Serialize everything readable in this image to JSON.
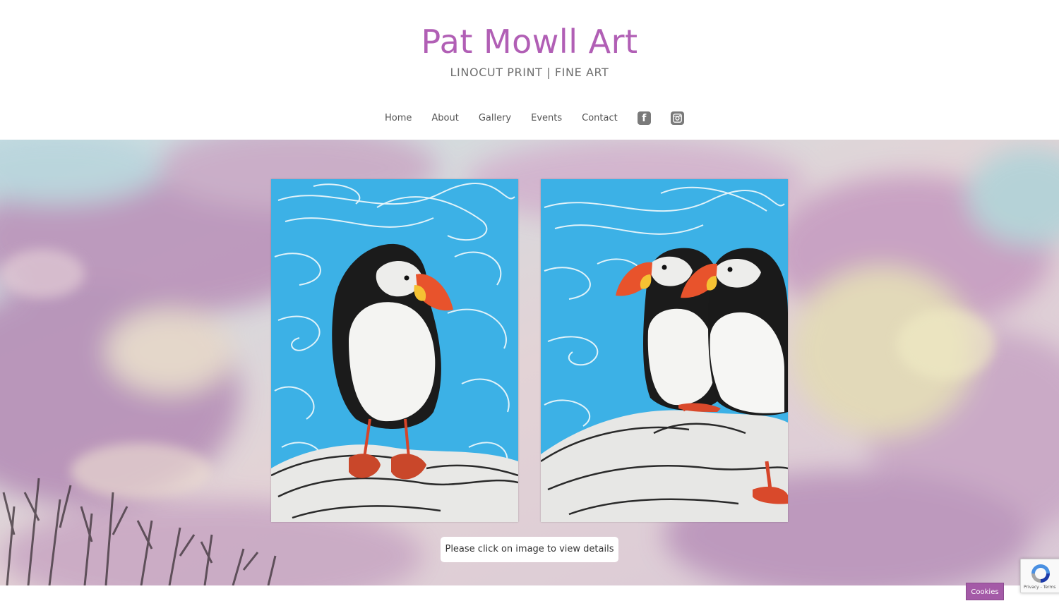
{
  "header": {
    "title": "Pat Mowll Art",
    "tagline": "LINOCUT PRINT | FINE ART"
  },
  "nav": {
    "items": [
      {
        "label": "Home"
      },
      {
        "label": "About"
      },
      {
        "label": "Gallery"
      },
      {
        "label": "Events"
      },
      {
        "label": "Contact"
      }
    ],
    "social": [
      {
        "icon": "facebook-icon"
      },
      {
        "icon": "instagram-icon"
      }
    ]
  },
  "hero": {
    "artworks": [
      {
        "subject": "single puffin on rocks"
      },
      {
        "subject": "two puffins on rocks"
      }
    ],
    "hint": "Please click on image to view details"
  },
  "recaptcha": {
    "terms": "Privacy - Terms"
  },
  "cookies": {
    "label": "Cookies"
  },
  "colors": {
    "brand": "#b15fb5",
    "tagline": "#707070",
    "nav_text": "#555555",
    "cookies_bg": "#a45aa7",
    "sky_blue": "#3fb0e3"
  }
}
